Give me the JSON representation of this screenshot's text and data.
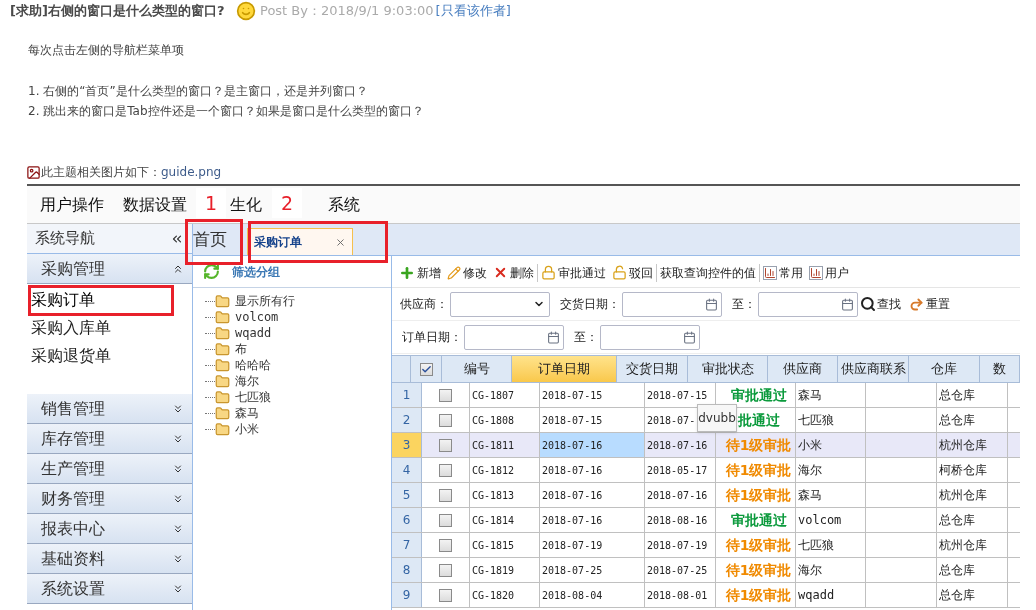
{
  "post": {
    "title": "[求助]右侧的窗口是什么类型的窗口?",
    "meta": "Post By：2018/9/1 9:03:00",
    "author_link": "[只看该作者]",
    "body": [
      "每次点击左侧的导航栏菜单项",
      "1. 右侧的“首页”是什么类型的窗口？是主窗口，还是并列窗口？",
      "2. 跳出来的窗口是Tab控件还是一个窗口？如果是窗口是什么类型的窗口？"
    ],
    "attachment_label": "此主题相关图片如下：",
    "attachment_link": "guide.png"
  },
  "app": {
    "menu": [
      "用户操作",
      "数据设置",
      "生化",
      "系统"
    ],
    "annotations": [
      "1",
      "2"
    ],
    "sidebar": {
      "title": "系统导航",
      "groups": [
        {
          "label": "采购管理",
          "expanded": true,
          "items": [
            {
              "label": "采购订单",
              "selected": true
            },
            {
              "label": "采购入库单",
              "selected": false
            },
            {
              "label": "采购退货单",
              "selected": false
            }
          ]
        },
        {
          "label": "销售管理",
          "expanded": false
        },
        {
          "label": "库存管理",
          "expanded": false
        },
        {
          "label": "生产管理",
          "expanded": false
        },
        {
          "label": "财务管理",
          "expanded": false
        },
        {
          "label": "报表中心",
          "expanded": false
        },
        {
          "label": "基础资料",
          "expanded": false
        },
        {
          "label": "系统设置",
          "expanded": false
        }
      ]
    },
    "tabs": [
      {
        "label": "首页",
        "selected": false,
        "closable": false
      },
      {
        "label": "采购订单",
        "selected": true,
        "closable": true
      }
    ],
    "tree": {
      "title": "筛选分组",
      "items": [
        "显示所有行",
        "volcom",
        "wqadd",
        "布",
        "哈哈哈",
        "海尔",
        "七匹狼",
        "森马",
        "小米"
      ]
    },
    "toolbar": [
      [
        {
          "label": "新增",
          "kind": "add"
        },
        {
          "label": "修改",
          "kind": "edit"
        },
        {
          "label": "删除",
          "kind": "delete"
        }
      ],
      [
        {
          "label": "审批通过",
          "kind": "lock"
        },
        {
          "label": "驳回",
          "kind": "unlock"
        }
      ],
      [
        {
          "label": "获取查询控件的值",
          "kind": "text"
        }
      ],
      [
        {
          "label": "常用",
          "kind": "chart"
        },
        {
          "label": "用户",
          "kind": "chart"
        }
      ]
    ],
    "filters": [
      [
        {
          "label": "供应商：",
          "kind": "select"
        },
        {
          "label": "交货日期：",
          "kind": "date"
        },
        {
          "label": "至：",
          "kind": "date"
        },
        {
          "label": "查找",
          "kind": "search"
        },
        {
          "label": "重置",
          "kind": "reset"
        }
      ],
      [
        {
          "label": "订单日期：",
          "kind": "date"
        },
        {
          "label": "至：",
          "kind": "date"
        }
      ]
    ],
    "table": {
      "all_checked": true,
      "columns": [
        {
          "label": "编号",
          "selected": false
        },
        {
          "label": "订单日期",
          "selected": true
        },
        {
          "label": "交货日期",
          "selected": false
        },
        {
          "label": "审批状态",
          "selected": false
        },
        {
          "label": "供应商",
          "selected": false
        },
        {
          "label": "供应商联系",
          "selected": false
        },
        {
          "label": "仓库",
          "selected": false
        },
        {
          "label": "数",
          "selected": false
        }
      ],
      "rows": [
        {
          "number": "1",
          "checked": false,
          "selected": false,
          "code": "CG-1807",
          "order_date": "2018-07-15",
          "delivery_date": "2018-07-15",
          "status": "审批通过",
          "kind": "approved",
          "supplier": "森马",
          "warehouse": "总仓库"
        },
        {
          "number": "2",
          "checked": false,
          "selected": false,
          "code": "CG-1808",
          "order_date": "2018-07-15",
          "delivery_date": "2018-07-",
          "status": "批通过",
          "kind": "approved",
          "supplier": "七匹狼",
          "warehouse": "总仓库"
        },
        {
          "number": "3",
          "checked": false,
          "selected": true,
          "code": "CG-1811",
          "order_date": "2018-07-16",
          "delivery_date": "2018-07-16",
          "status": "待1级审批",
          "kind": "pending",
          "supplier": "小米",
          "warehouse": "杭州仓库"
        },
        {
          "number": "4",
          "checked": false,
          "selected": false,
          "code": "CG-1812",
          "order_date": "2018-07-16",
          "delivery_date": "2018-05-17",
          "status": "待1级审批",
          "kind": "pending",
          "supplier": "海尔",
          "warehouse": "柯桥仓库"
        },
        {
          "number": "5",
          "checked": false,
          "selected": false,
          "code": "CG-1813",
          "order_date": "2018-07-16",
          "delivery_date": "2018-07-16",
          "status": "待1级审批",
          "kind": "pending",
          "supplier": "森马",
          "warehouse": "杭州仓库"
        },
        {
          "number": "6",
          "checked": false,
          "selected": false,
          "code": "CG-1814",
          "order_date": "2018-07-16",
          "delivery_date": "2018-08-16",
          "status": "审批通过",
          "kind": "approved",
          "supplier": "volcom",
          "warehouse": "总仓库"
        },
        {
          "number": "7",
          "checked": false,
          "selected": false,
          "code": "CG-1815",
          "order_date": "2018-07-19",
          "delivery_date": "2018-07-19",
          "status": "待1级审批",
          "kind": "pending",
          "supplier": "七匹狼",
          "warehouse": "杭州仓库"
        },
        {
          "number": "8",
          "checked": false,
          "selected": false,
          "code": "CG-1819",
          "order_date": "2018-07-25",
          "delivery_date": "2018-07-25",
          "status": "待1级审批",
          "kind": "pending",
          "supplier": "海尔",
          "warehouse": "总仓库"
        },
        {
          "number": "9",
          "checked": false,
          "selected": false,
          "code": "CG-1820",
          "order_date": "2018-08-04",
          "delivery_date": "2018-08-01",
          "status": "待1级审批",
          "kind": "pending",
          "supplier": "wqadd",
          "warehouse": "总仓库"
        }
      ]
    },
    "tooltip": "dvubb"
  }
}
